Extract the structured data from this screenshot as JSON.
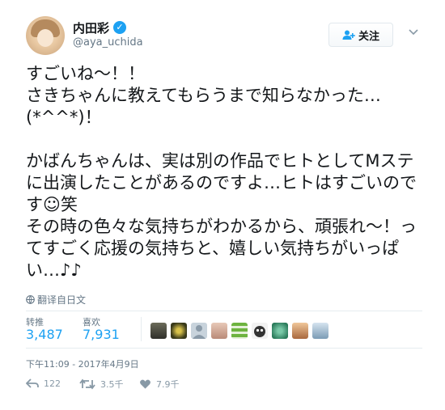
{
  "user": {
    "display_name": "内田彩",
    "handle": "@aya_uchida",
    "verified_icon": "✓"
  },
  "header": {
    "follow_label": "关注",
    "follow_icon": "person-add-icon",
    "caret_icon": "chevron-down-icon"
  },
  "tweet": {
    "text": "すごいね～！！\nさきちゃんに教えてもらうまで知らなかった…(*^^*)！\n\nかばんちゃんは、実は別の作品でヒトとしてMステに出演したことがあるのですよ…ヒトはすごいのです☺笑\nその時の色々な気持ちがわかるから、頑張れ～！ってすごく応援の気持ちと、嬉しい気持ちがいっぱい…♪♪",
    "translate_label": "翻译自日文"
  },
  "stats": {
    "retweets_label": "转推",
    "retweets_value": "3,487",
    "likes_label": "喜欢",
    "likes_value": "7,931"
  },
  "timestamp": "下午11:09 - 2017年4月9日",
  "actions": {
    "reply_count": "122",
    "retweet_count": "3.5千",
    "like_count": "7.9千"
  },
  "colors": {
    "accent": "#1da1f2",
    "muted": "#657786"
  }
}
